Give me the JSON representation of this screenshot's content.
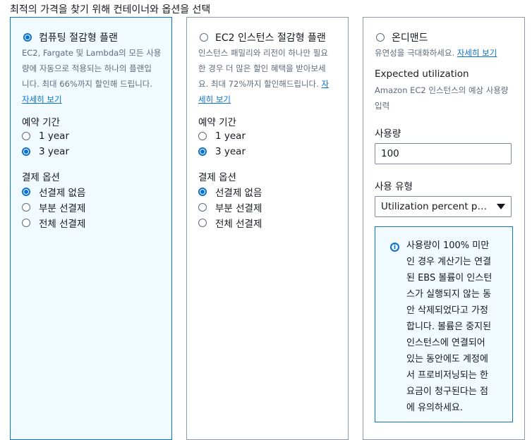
{
  "page": {
    "title": "최적의 가격을 찾기 위해 컨테이너와 옵션을 선택"
  },
  "savings": {
    "title": "컴퓨팅 절감형 플랜",
    "desc_lines": [
      "EC2, Fargate 및 Lambda의 모든 사용",
      "량에 자동으로 적용되는 하나의 플랜입",
      "니다. 최대 66%까지 할인해 드립니다."
    ],
    "learn_more": "자세히 보기",
    "term_label": "예약 기간",
    "term_1": "1 year",
    "term_3": "3 year",
    "payment_label": "결제 옵션",
    "pay_none": "선결제 없음",
    "pay_partial": "부분 선결제",
    "pay_all": "전체 선결제"
  },
  "ec2": {
    "title": "EC2 인스턴스 절감형 플랜",
    "desc_lines": [
      "인스턴스 패밀리와 리전이 하나만 필요",
      "한 경우 더 많은 할인 혜택을 받아보세"
    ],
    "desc_last": "요. 최대 72%까지 할인해드립니다. ",
    "learn_more_a": "자",
    "learn_more_b": "세히 보기",
    "term_label": "예약 기간",
    "term_1": "1 year",
    "term_3": "3 year",
    "payment_label": "결제 옵션",
    "pay_none": "선결제 없음",
    "pay_partial": "부분 선결제",
    "pay_all": "전체 선결제"
  },
  "ondemand": {
    "title": "온디맨드",
    "desc": "유연성을 극대화하세요. ",
    "learn_more": "자세히 보기",
    "utilization_label": "Expected utilization",
    "utilization_help_1": "Amazon EC2 인스턴스의 예상 사용량",
    "utilization_help_2": "입력",
    "usage_label": "사용량",
    "usage_value": "100",
    "usage_type_label": "사용 유형",
    "usage_type_value": "Utilization percent per month",
    "info_lines": [
      "사용량이 100% 미만",
      "인 경우 계산기는 연결",
      "된 EBS 볼륨이 인스턴",
      "스가 실행되지 않는 동",
      "안 삭제되었다고 가정",
      "합니다. 볼륨은 중지된",
      "인스턴스에 연결되어",
      "있는 동안에도 계정에",
      "서 프로비저닝되는 한",
      "요금이 청구된다는 점",
      "에 유의하세요."
    ]
  },
  "colors": {
    "accent": "#0972d3",
    "selected_bg": "#f1faff",
    "border": "#8d99a8"
  }
}
